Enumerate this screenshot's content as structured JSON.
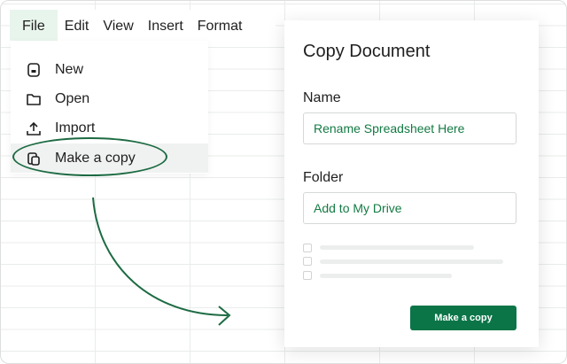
{
  "menubar": {
    "items": [
      "File",
      "Edit",
      "View",
      "Insert",
      "Format"
    ]
  },
  "file_menu": {
    "items": [
      {
        "label": "New",
        "icon": "new-sheet-icon"
      },
      {
        "label": "Open",
        "icon": "folder-icon"
      },
      {
        "label": "Import",
        "icon": "upload-icon"
      },
      {
        "label": "Make a copy",
        "icon": "copy-icon"
      }
    ]
  },
  "dialog": {
    "title": "Copy Document",
    "name_label": "Name",
    "name_value": "Rename Spreadsheet Here",
    "folder_label": "Folder",
    "folder_value": "Add to My Drive",
    "submit_label": "Make a copy"
  },
  "colors": {
    "accent": "#0b7548",
    "highlight": "#e8f5ec"
  }
}
